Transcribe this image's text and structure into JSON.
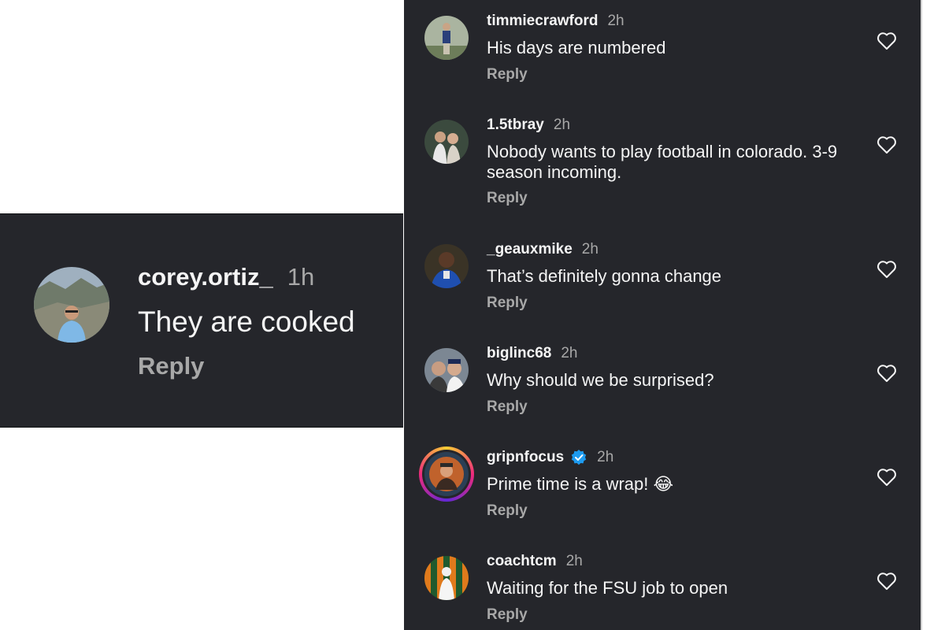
{
  "featured_comment": {
    "username": "corey.ortiz_",
    "time": "1h",
    "text": "They are cooked",
    "reply_label": "Reply"
  },
  "comments": [
    {
      "username": "timmiecrawford",
      "time": "2h",
      "text": "His days are numbered",
      "reply_label": "Reply",
      "verified": false
    },
    {
      "username": "1.5tbray",
      "time": "2h",
      "text": "Nobody wants to play football in colorado. 3-9 season incoming.",
      "reply_label": "Reply",
      "verified": false
    },
    {
      "username": "_geauxmike",
      "time": "2h",
      "text": "That’s definitely gonna change",
      "reply_label": "Reply",
      "verified": false
    },
    {
      "username": "biglinc68",
      "time": "2h",
      "text": "Why should we be surprised?",
      "reply_label": "Reply",
      "verified": false
    },
    {
      "username": "gripnfocus",
      "time": "2h",
      "text": "Prime time is a wrap! 😂",
      "reply_label": "Reply",
      "verified": true
    },
    {
      "username": "coachtcm",
      "time": "2h",
      "text": "Waiting for the FSU job to open",
      "reply_label": "Reply",
      "verified": false
    }
  ],
  "icons": {
    "like": "heart-icon",
    "verified": "verified-badge-icon"
  },
  "colors": {
    "background": "#25262b",
    "primary_text": "#f5f5f5",
    "secondary_text": "#a8a8a8",
    "verified_blue": "#1d9bf0"
  }
}
